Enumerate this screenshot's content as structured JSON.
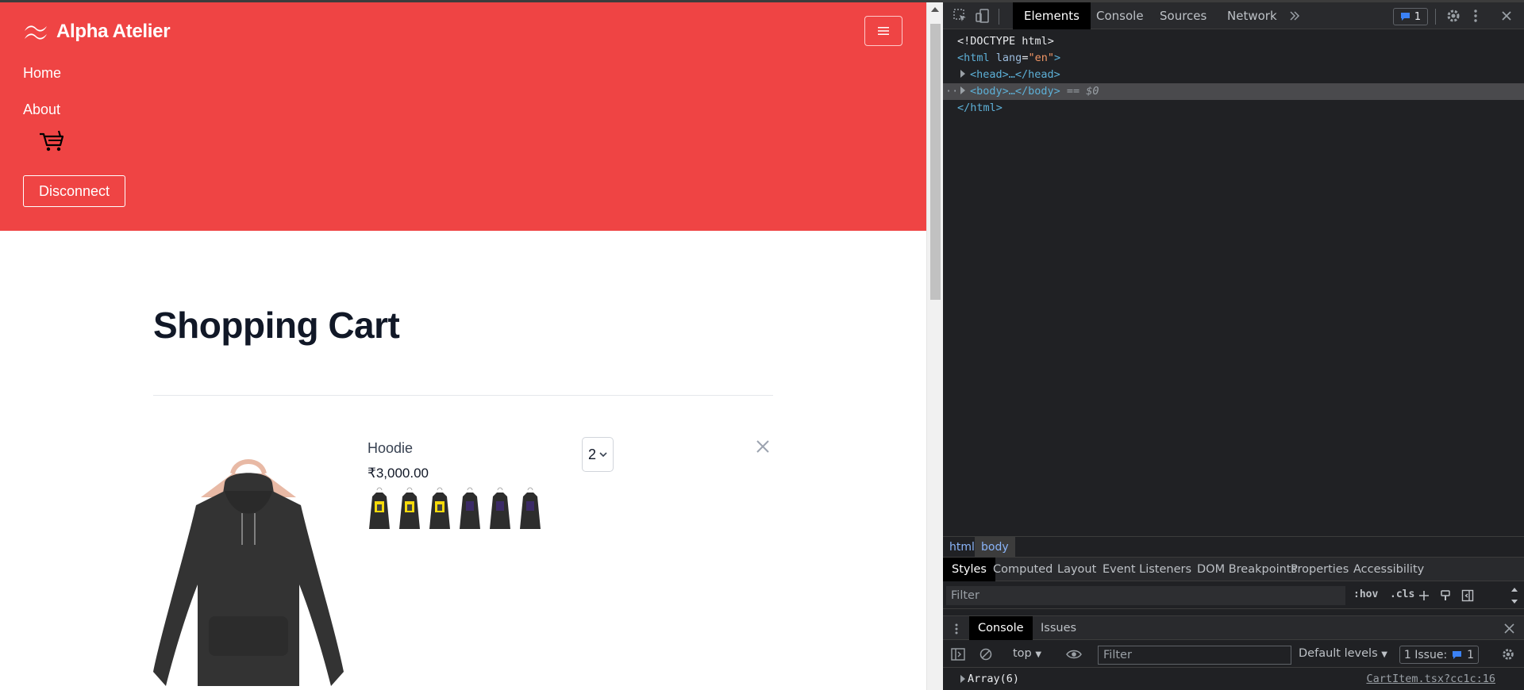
{
  "page": {
    "brand": "Alpha Atelier",
    "nav": {
      "home": "Home",
      "about": "About"
    },
    "disconnect_label": "Disconnect",
    "title": "Shopping Cart",
    "cart_item": {
      "name": "Hoodie",
      "price": "₹3,000.00",
      "quantity": "2"
    },
    "colors": {
      "navbar": "#ef4444",
      "title": "#111827"
    }
  },
  "devtools": {
    "tabs": [
      "Elements",
      "Console",
      "Sources",
      "Network"
    ],
    "issues_count": "1",
    "dom": {
      "doctype": "<!DOCTYPE html>",
      "html_open_tag": "html",
      "html_attr": "lang",
      "html_attr_val": "\"en\"",
      "head": "<head>…</head>",
      "body": "<body>…</body>",
      "body_suffix": " == $0",
      "html_close": "</html>"
    },
    "crumbs": [
      "html",
      "body"
    ],
    "styles_tabs": [
      "Styles",
      "Computed",
      "Layout",
      "Event Listeners",
      "DOM Breakpoints",
      "Properties",
      "Accessibility"
    ],
    "filter_placeholder": "Filter",
    "hov": ":hov",
    "cls": ".cls",
    "drawer_tabs": [
      "Console",
      "Issues"
    ],
    "console": {
      "context": "top",
      "filter_placeholder": "Filter",
      "levels": "Default levels",
      "issue_chip": "1 Issue:",
      "issue_chip_count": "1",
      "log_value": "Array(6)",
      "log_source": "CartItem.tsx?cc1c:16"
    }
  }
}
